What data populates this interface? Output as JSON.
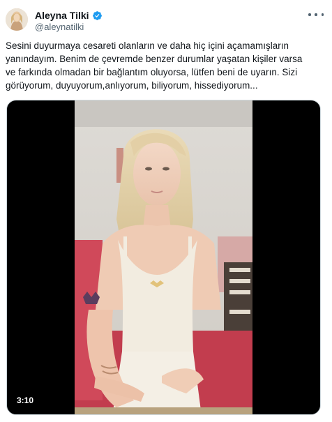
{
  "author": {
    "display_name": "Aleyna Tilki",
    "handle": "@aleynatilki",
    "verified": true,
    "verified_color": "#1d9bf0"
  },
  "tweet": {
    "text": "Sesini duyurmaya cesareti olanların ve daha hiç içini açamamışların\nyanındayım. Benim de çevremde benzer durumlar yaşatan kişiler varsa\nve farkında olmadan bir bağlantım oluyorsa, lütfen beni de uyarın. Sizi\ngörüyorum, duyuyorum,anlıyorum, biliyorum, hissediyorum..."
  },
  "media": {
    "type": "video",
    "duration": "3:10"
  },
  "icons": {
    "verified": "verified-badge-icon",
    "more": "more-options-icon"
  },
  "colors": {
    "text_primary": "#0f1419",
    "text_secondary": "#536471",
    "accent": "#1d9bf0",
    "background": "#ffffff"
  }
}
